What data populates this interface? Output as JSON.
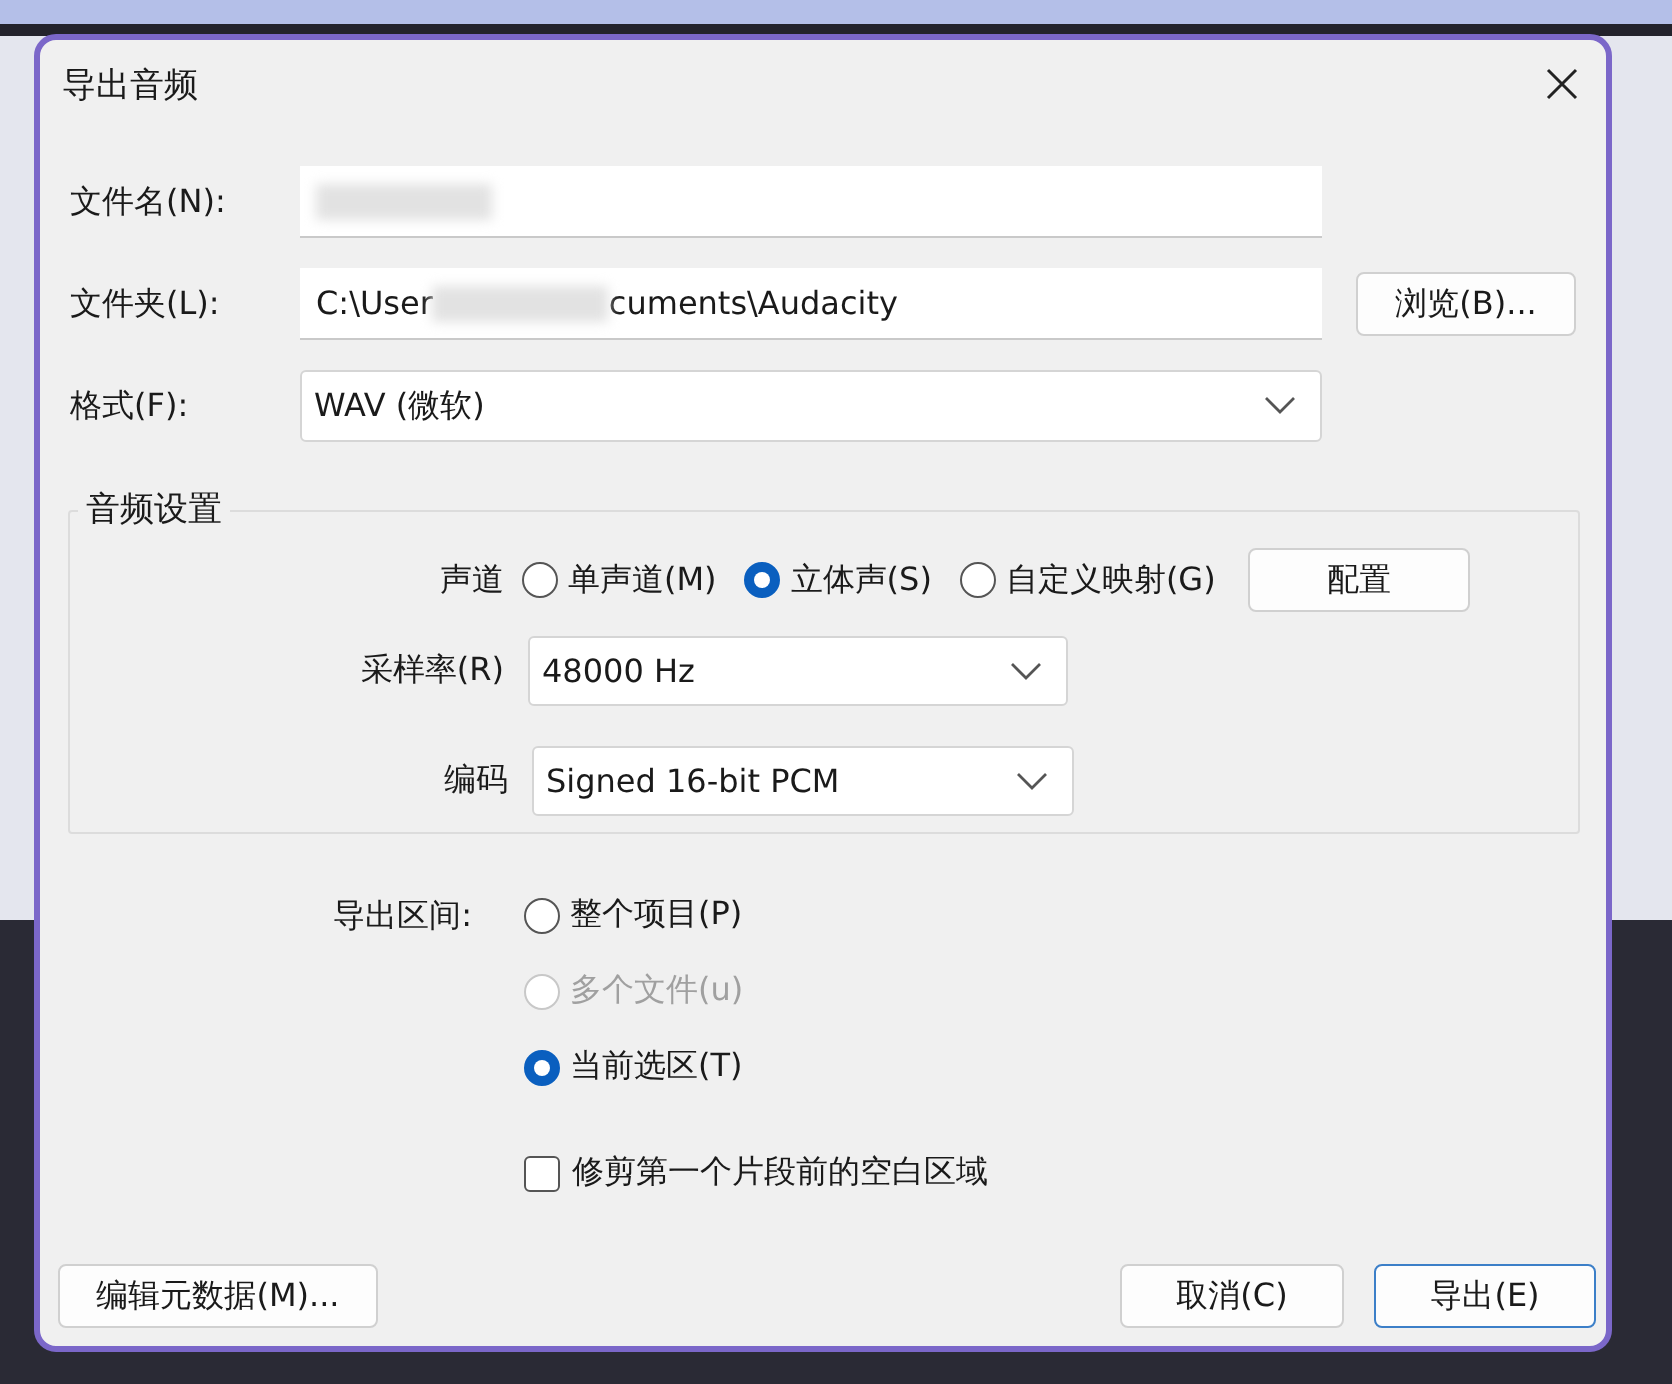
{
  "window": {
    "title": "导出音频"
  },
  "file_name": {
    "label": "文件名(N):",
    "redacted": true
  },
  "folder": {
    "label": "文件夹(L):",
    "value_start": "C:\\User",
    "value_end": "cuments\\Audacity",
    "redacted": true,
    "browse_button": "浏览(B)..."
  },
  "format": {
    "label": "格式(F):",
    "value": "WAV (微软)"
  },
  "audio_settings": {
    "title": "音频设置",
    "channels": {
      "label": "声道",
      "options": [
        {
          "label": "单声道(M)",
          "selected": false
        },
        {
          "label": "立体声(S)",
          "selected": true
        },
        {
          "label": "自定义映射(G)",
          "selected": false
        }
      ],
      "configure_button": "配置"
    },
    "sample_rate": {
      "label": "采样率(R)",
      "value": "48000 Hz"
    },
    "encoding": {
      "label": "编码",
      "value": "Signed 16-bit PCM"
    }
  },
  "export_range": {
    "label": "导出区间:",
    "options": [
      {
        "label": "整个项目(P)",
        "selected": false,
        "disabled": false
      },
      {
        "label": "多个文件(u)",
        "selected": false,
        "disabled": true
      },
      {
        "label": "当前选区(T)",
        "selected": true,
        "disabled": false
      }
    ]
  },
  "trim_option": {
    "label": "修剪第一个片段前的空白区域",
    "checked": false
  },
  "buttons": [
    {
      "label": "编辑元数据(M)...",
      "default": false
    },
    {
      "label": "取消(C)",
      "default": false
    },
    {
      "label": "导出(E)",
      "default": true
    }
  ]
}
